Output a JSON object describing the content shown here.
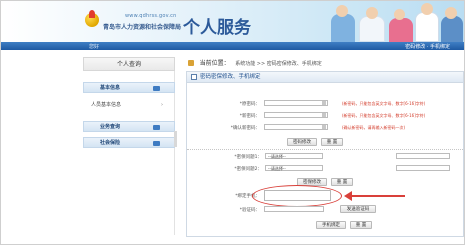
{
  "header": {
    "site_url": "www.qdhrss.gov.cn",
    "bureau_name": "青岛市人力资源和社会保障局",
    "service_title": "个人服务"
  },
  "topbar": {
    "user": "您好",
    "links": "密码修改 · 手机绑定"
  },
  "sidebar": {
    "title": "个人查询",
    "sections": [
      {
        "label": "基本信息"
      },
      {
        "label": "人员基本信息",
        "type": "item"
      },
      {
        "label": "业务查询"
      },
      {
        "label": "社会保险"
      }
    ]
  },
  "breadcrumb": {
    "here": "当前位置：",
    "path": "系统功能 >> 密码密保修改、手机绑定"
  },
  "panel": {
    "title": "密码密保修改、手机绑定",
    "password": {
      "old_label": "*原密码：",
      "new_label": "*新密码：",
      "confirm_label": "*确认新密码：",
      "hint_new": "(新密码，只能包含英文字母、数字[6-16]字符)",
      "hint_confirm": "(新密码，只能包含英文字母、数字[6-16]字符)",
      "hint_repeat": "(确认新密码，请再输入新密码一次)",
      "submit": "密码修改",
      "reset": "重 置"
    },
    "security": {
      "q1_label": "*密保问题1：",
      "q2_label": "*密保问题2：",
      "select_placeholder": "--请选择--",
      "submit": "密保修改",
      "reset": "重 置"
    },
    "phone": {
      "phone_label": "*绑定手机：",
      "code_label": "*验证码：",
      "send_code": "发送验证码",
      "submit": "手机绑定",
      "reset": "重 置"
    }
  },
  "colors": {
    "accent_blue": "#1f5aa3",
    "annotation_red": "#d9403a"
  }
}
